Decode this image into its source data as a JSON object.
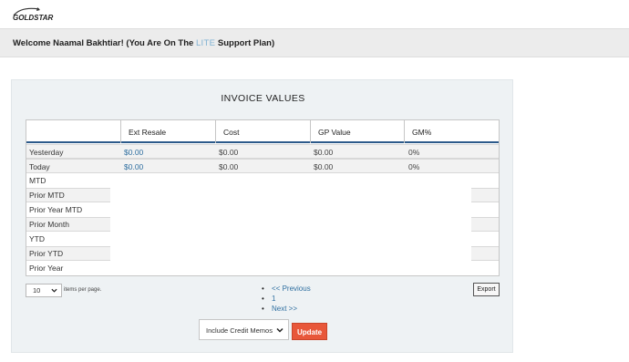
{
  "header": {
    "logo_text": "GOLDSTAR"
  },
  "welcome": {
    "prefix": "Welcome Naamal Bakhtiar! (You Are On The ",
    "plan": "LITE",
    "suffix": " Support Plan)"
  },
  "panel": {
    "title": "INVOICE VALUES"
  },
  "table": {
    "columns": [
      "",
      "Ext Resale",
      "Cost",
      "GP Value",
      "GM%"
    ],
    "rows": [
      {
        "label": "Yesterday",
        "ext_resale": "$0.00",
        "cost": "$0.00",
        "gp_value": "$0.00",
        "gm": "0%"
      },
      {
        "label": "Today",
        "ext_resale": "$0.00",
        "cost": "$0.00",
        "gp_value": "$0.00",
        "gm": "0%"
      }
    ],
    "empty_rows": [
      "MTD",
      "Prior MTD",
      "Prior Year MTD",
      "Prior Month",
      "YTD",
      "Prior YTD",
      "Prior Year"
    ]
  },
  "pager": {
    "page_size": "10",
    "items_per_page_label": "items per page.",
    "previous": "<< Previous",
    "current": "1",
    "next": "Next >>",
    "export_label": "Export"
  },
  "filter": {
    "credit_memos": "Include Credit Memos",
    "update_label": "Update"
  },
  "colors": {
    "accent_blue": "#2c5a8a",
    "link": "#2f6fa0",
    "update_button": "#e8573a",
    "plan_highlight": "#7fb2d3"
  }
}
